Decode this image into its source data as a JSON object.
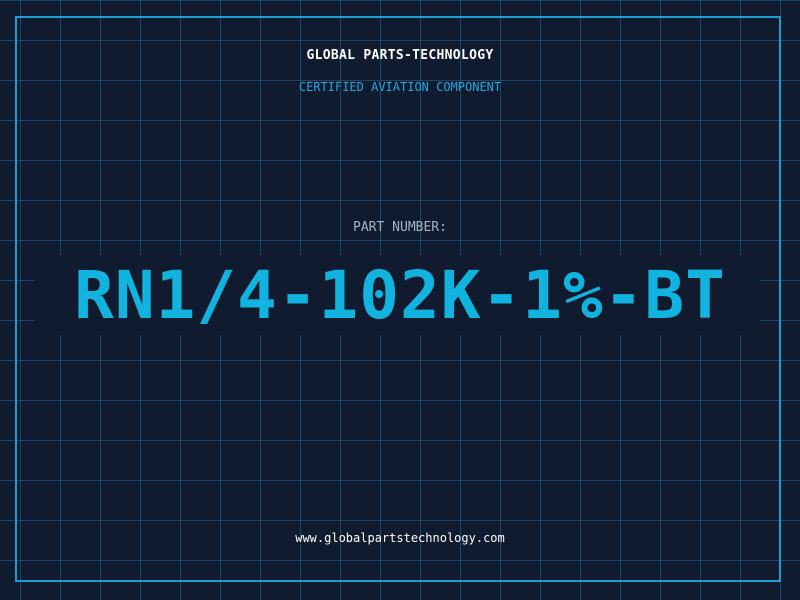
{
  "header": {
    "company_name": "GLOBAL PARTS-TECHNOLOGY",
    "tagline": "CERTIFIED AVIATION COMPONENT"
  },
  "part": {
    "label": "PART NUMBER:",
    "number": "RN1/4-102K-1%-BT"
  },
  "footer": {
    "website": "www.globalpartstechnology.com"
  },
  "colors": {
    "background": "#111b30",
    "grid": "#1e6e96",
    "frame": "#1a9fcf",
    "accent": "#10b4de",
    "heading": "#ffffff",
    "label": "#a9b3c3"
  }
}
